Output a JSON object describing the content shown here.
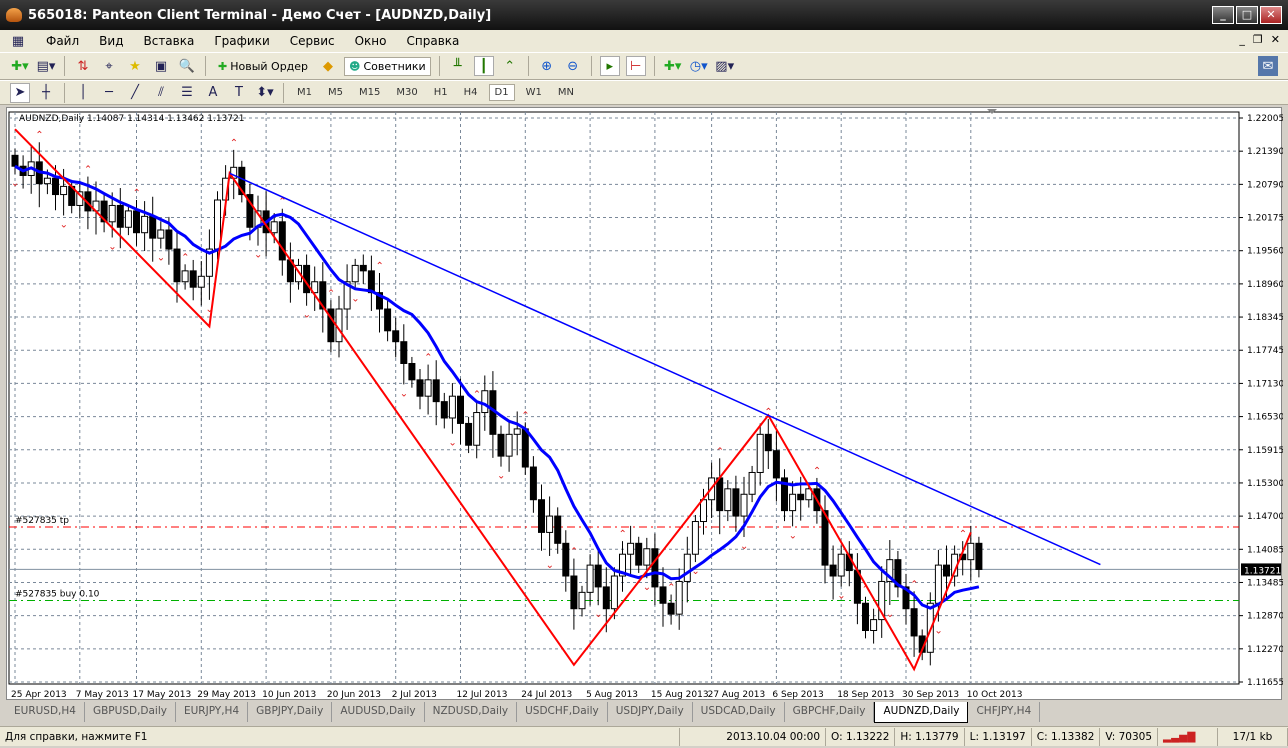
{
  "window": {
    "title": "565018: Panteon Client Terminal - Демо Счет - [AUDNZD,Daily]"
  },
  "menu": [
    "Файл",
    "Вид",
    "Вставка",
    "Графики",
    "Сервис",
    "Окно",
    "Справка"
  ],
  "toolbar": {
    "new_order": "Новый Ордер",
    "experts": "Советники"
  },
  "timeframes": [
    "M1",
    "M5",
    "M15",
    "M30",
    "H1",
    "H4",
    "D1",
    "W1",
    "MN"
  ],
  "active_timeframe": "D1",
  "chart_data": {
    "type": "candlestick",
    "title": "AUDNZD,Daily  1.14087 1.14314 1.13462 1.13721",
    "symbol": "AUDNZD,Daily",
    "ylim": [
      1.11655,
      1.22005
    ],
    "yticks": [
      "1.22005",
      "1.21390",
      "1.20790",
      "1.20175",
      "1.19560",
      "1.18960",
      "1.18345",
      "1.17745",
      "1.17130",
      "1.16530",
      "1.15915",
      "1.15300",
      "1.14700",
      "1.14085",
      "1.13485",
      "1.12870",
      "1.12270",
      "1.11655"
    ],
    "current_price": "1.13721",
    "xlabels": [
      {
        "i": 0,
        "t": "25 Apr 2013"
      },
      {
        "i": 8,
        "t": "7 May 2013"
      },
      {
        "i": 15,
        "t": "17 May 2013"
      },
      {
        "i": 23,
        "t": "29 May 2013"
      },
      {
        "i": 31,
        "t": "10 Jun 2013"
      },
      {
        "i": 39,
        "t": "20 Jun 2013"
      },
      {
        "i": 47,
        "t": "2 Jul 2013"
      },
      {
        "i": 55,
        "t": "12 Jul 2013"
      },
      {
        "i": 63,
        "t": "24 Jul 2013"
      },
      {
        "i": 71,
        "t": "5 Aug 2013"
      },
      {
        "i": 79,
        "t": "15 Aug 2013"
      },
      {
        "i": 86,
        "t": "27 Aug 2013"
      },
      {
        "i": 94,
        "t": "6 Sep 2013"
      },
      {
        "i": 102,
        "t": "18 Sep 2013"
      },
      {
        "i": 110,
        "t": "30 Sep 2013"
      },
      {
        "i": 118,
        "t": "10 Oct 2013"
      }
    ],
    "closes": [
      1.2112,
      1.2095,
      1.212,
      1.208,
      1.209,
      1.206,
      1.2075,
      1.204,
      1.2065,
      1.203,
      1.2048,
      1.201,
      1.204,
      1.2,
      1.203,
      1.199,
      1.202,
      1.198,
      1.1995,
      1.196,
      1.19,
      1.192,
      1.189,
      1.191,
      1.196,
      1.205,
      1.209,
      1.211,
      1.206,
      1.2,
      1.203,
      1.199,
      1.201,
      1.194,
      1.19,
      1.193,
      1.188,
      1.19,
      1.185,
      1.179,
      1.185,
      1.19,
      1.193,
      1.192,
      1.188,
      1.185,
      1.181,
      1.179,
      1.175,
      1.172,
      1.169,
      1.172,
      1.168,
      1.165,
      1.169,
      1.164,
      1.16,
      1.166,
      1.17,
      1.162,
      1.158,
      1.162,
      1.163,
      1.156,
      1.15,
      1.144,
      1.147,
      1.142,
      1.136,
      1.13,
      1.133,
      1.138,
      1.134,
      1.13,
      1.136,
      1.14,
      1.142,
      1.138,
      1.141,
      1.134,
      1.131,
      1.129,
      1.135,
      1.14,
      1.146,
      1.15,
      1.154,
      1.148,
      1.152,
      1.147,
      1.151,
      1.155,
      1.162,
      1.159,
      1.154,
      1.148,
      1.151,
      1.15,
      1.152,
      1.148,
      1.138,
      1.136,
      1.14,
      1.137,
      1.131,
      1.126,
      1.128,
      1.135,
      1.139,
      1.134,
      1.13,
      1.125,
      1.122,
      1.131,
      1.138,
      1.136,
      1.14,
      1.139,
      1.142,
      1.1372
    ],
    "zigzag": [
      [
        0,
        1.218
      ],
      [
        24,
        1.1818
      ],
      [
        26.5,
        1.2099
      ],
      [
        69,
        1.1197
      ],
      [
        93,
        1.1655
      ],
      [
        111,
        1.1189
      ],
      [
        118,
        1.144
      ]
    ],
    "trendline": [
      [
        26.5,
        1.2099
      ],
      [
        134,
        1.1381
      ]
    ],
    "ma_period": 10,
    "levels": [
      {
        "label": "#527835 tp",
        "price": 1.145,
        "color": "#ff0000"
      },
      {
        "label": "#527835 buy 0.10",
        "price": 1.1315,
        "color": "#00b000"
      }
    ]
  },
  "tabs": [
    "EURUSD,H4",
    "GBPUSD,Daily",
    "EURJPY,H4",
    "GBPJPY,Daily",
    "AUDUSD,Daily",
    "NZDUSD,Daily",
    "USDCHF,Daily",
    "USDJPY,Daily",
    "USDCAD,Daily",
    "GBPCHF,Daily",
    "AUDNZD,Daily",
    "CHFJPY,H4"
  ],
  "active_tab": "AUDNZD,Daily",
  "status": {
    "help": "Для справки, нажмите F1",
    "time": "2013.10.04 00:00",
    "open": "O: 1.13222",
    "high": "H: 1.13779",
    "low": "L: 1.13197",
    "close": "C: 1.13382",
    "volume": "V: 70305",
    "traffic": "17/1 kb"
  }
}
